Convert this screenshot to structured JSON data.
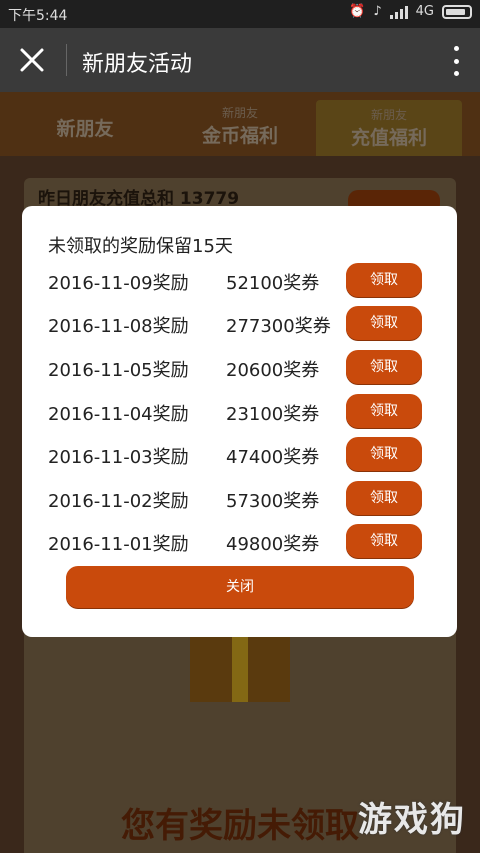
{
  "status_bar": {
    "time": "下午5:44",
    "network": "4G",
    "icons": [
      "alarm-icon",
      "mute-icon",
      "signal-icon",
      "battery-icon"
    ]
  },
  "app_bar": {
    "title": "新朋友活动",
    "close_icon": "close-icon",
    "more_icon": "more-vertical-icon"
  },
  "tabs": [
    {
      "label": "新朋友",
      "sub": ""
    },
    {
      "label": "金币福利",
      "sub": "新朋友"
    },
    {
      "label": "充值福利",
      "sub": "新朋友"
    }
  ],
  "background": {
    "summary_text": "昨日朋友充值总和 13779",
    "banner_text": "您有奖励未领取",
    "watermark": "游戏狗"
  },
  "modal": {
    "heading": "未领取的奖励保留15天",
    "rewards": [
      {
        "date": "2016-11-09奖励",
        "amount": "52100奖券",
        "button": "领取"
      },
      {
        "date": "2016-11-08奖励",
        "amount": "277300奖券",
        "button": "领取"
      },
      {
        "date": "2016-11-05奖励",
        "amount": "20600奖券",
        "button": "领取"
      },
      {
        "date": "2016-11-04奖励",
        "amount": "23100奖券",
        "button": "领取"
      },
      {
        "date": "2016-11-03奖励",
        "amount": "47400奖券",
        "button": "领取"
      },
      {
        "date": "2016-11-02奖励",
        "amount": "57300奖券",
        "button": "领取"
      },
      {
        "date": "2016-11-01奖励",
        "amount": "49800奖券",
        "button": "领取"
      }
    ],
    "close_label": "关闭"
  },
  "colors": {
    "accent": "#c94a0c",
    "modal_bg": "#ffffff",
    "app_bar": "#3a3a3a"
  }
}
